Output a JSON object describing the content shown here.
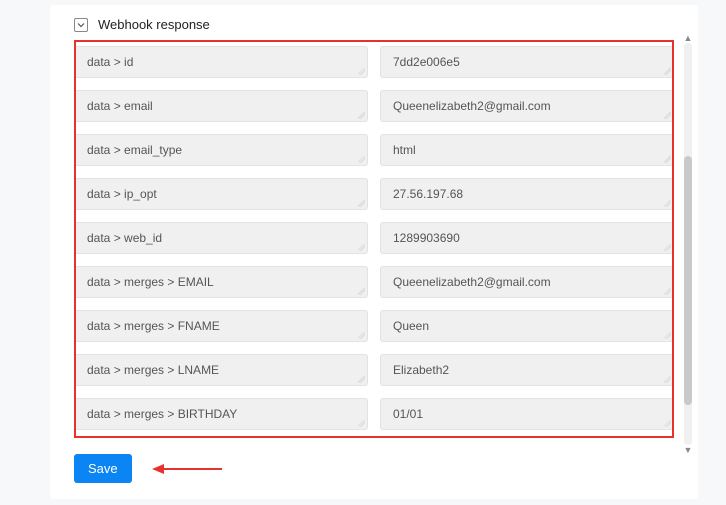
{
  "header": {
    "title": "Webhook response"
  },
  "rows": [
    {
      "key": "data > id",
      "value": "7dd2e006e5"
    },
    {
      "key": "data > email",
      "value": "Queenelizabeth2@gmail.com"
    },
    {
      "key": "data > email_type",
      "value": "html"
    },
    {
      "key": "data > ip_opt",
      "value": "27.56.197.68"
    },
    {
      "key": "data > web_id",
      "value": "1289903690"
    },
    {
      "key": "data > merges > EMAIL",
      "value": "Queenelizabeth2@gmail.com"
    },
    {
      "key": "data > merges > FNAME",
      "value": "Queen"
    },
    {
      "key": "data > merges > LNAME",
      "value": "Elizabeth2"
    },
    {
      "key": "data > merges > BIRTHDAY",
      "value": "01/01"
    }
  ],
  "footer": {
    "save_label": "Save"
  }
}
